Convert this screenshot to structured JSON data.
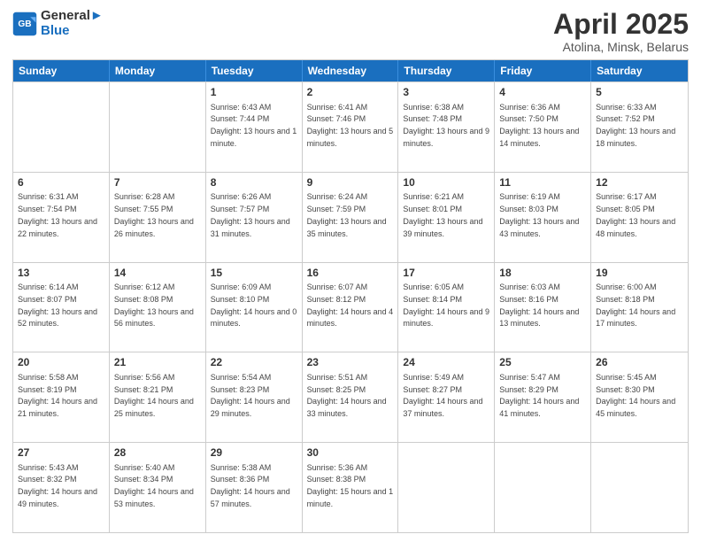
{
  "logo": {
    "line1": "General",
    "line2": "Blue"
  },
  "title": "April 2025",
  "location": "Atolina, Minsk, Belarus",
  "days": [
    "Sunday",
    "Monday",
    "Tuesday",
    "Wednesday",
    "Thursday",
    "Friday",
    "Saturday"
  ],
  "rows": [
    [
      {
        "day": "",
        "sunrise": "",
        "sunset": "",
        "daylight": ""
      },
      {
        "day": "",
        "sunrise": "",
        "sunset": "",
        "daylight": ""
      },
      {
        "day": "1",
        "sunrise": "Sunrise: 6:43 AM",
        "sunset": "Sunset: 7:44 PM",
        "daylight": "Daylight: 13 hours and 1 minute."
      },
      {
        "day": "2",
        "sunrise": "Sunrise: 6:41 AM",
        "sunset": "Sunset: 7:46 PM",
        "daylight": "Daylight: 13 hours and 5 minutes."
      },
      {
        "day": "3",
        "sunrise": "Sunrise: 6:38 AM",
        "sunset": "Sunset: 7:48 PM",
        "daylight": "Daylight: 13 hours and 9 minutes."
      },
      {
        "day": "4",
        "sunrise": "Sunrise: 6:36 AM",
        "sunset": "Sunset: 7:50 PM",
        "daylight": "Daylight: 13 hours and 14 minutes."
      },
      {
        "day": "5",
        "sunrise": "Sunrise: 6:33 AM",
        "sunset": "Sunset: 7:52 PM",
        "daylight": "Daylight: 13 hours and 18 minutes."
      }
    ],
    [
      {
        "day": "6",
        "sunrise": "Sunrise: 6:31 AM",
        "sunset": "Sunset: 7:54 PM",
        "daylight": "Daylight: 13 hours and 22 minutes."
      },
      {
        "day": "7",
        "sunrise": "Sunrise: 6:28 AM",
        "sunset": "Sunset: 7:55 PM",
        "daylight": "Daylight: 13 hours and 26 minutes."
      },
      {
        "day": "8",
        "sunrise": "Sunrise: 6:26 AM",
        "sunset": "Sunset: 7:57 PM",
        "daylight": "Daylight: 13 hours and 31 minutes."
      },
      {
        "day": "9",
        "sunrise": "Sunrise: 6:24 AM",
        "sunset": "Sunset: 7:59 PM",
        "daylight": "Daylight: 13 hours and 35 minutes."
      },
      {
        "day": "10",
        "sunrise": "Sunrise: 6:21 AM",
        "sunset": "Sunset: 8:01 PM",
        "daylight": "Daylight: 13 hours and 39 minutes."
      },
      {
        "day": "11",
        "sunrise": "Sunrise: 6:19 AM",
        "sunset": "Sunset: 8:03 PM",
        "daylight": "Daylight: 13 hours and 43 minutes."
      },
      {
        "day": "12",
        "sunrise": "Sunrise: 6:17 AM",
        "sunset": "Sunset: 8:05 PM",
        "daylight": "Daylight: 13 hours and 48 minutes."
      }
    ],
    [
      {
        "day": "13",
        "sunrise": "Sunrise: 6:14 AM",
        "sunset": "Sunset: 8:07 PM",
        "daylight": "Daylight: 13 hours and 52 minutes."
      },
      {
        "day": "14",
        "sunrise": "Sunrise: 6:12 AM",
        "sunset": "Sunset: 8:08 PM",
        "daylight": "Daylight: 13 hours and 56 minutes."
      },
      {
        "day": "15",
        "sunrise": "Sunrise: 6:09 AM",
        "sunset": "Sunset: 8:10 PM",
        "daylight": "Daylight: 14 hours and 0 minutes."
      },
      {
        "day": "16",
        "sunrise": "Sunrise: 6:07 AM",
        "sunset": "Sunset: 8:12 PM",
        "daylight": "Daylight: 14 hours and 4 minutes."
      },
      {
        "day": "17",
        "sunrise": "Sunrise: 6:05 AM",
        "sunset": "Sunset: 8:14 PM",
        "daylight": "Daylight: 14 hours and 9 minutes."
      },
      {
        "day": "18",
        "sunrise": "Sunrise: 6:03 AM",
        "sunset": "Sunset: 8:16 PM",
        "daylight": "Daylight: 14 hours and 13 minutes."
      },
      {
        "day": "19",
        "sunrise": "Sunrise: 6:00 AM",
        "sunset": "Sunset: 8:18 PM",
        "daylight": "Daylight: 14 hours and 17 minutes."
      }
    ],
    [
      {
        "day": "20",
        "sunrise": "Sunrise: 5:58 AM",
        "sunset": "Sunset: 8:19 PM",
        "daylight": "Daylight: 14 hours and 21 minutes."
      },
      {
        "day": "21",
        "sunrise": "Sunrise: 5:56 AM",
        "sunset": "Sunset: 8:21 PM",
        "daylight": "Daylight: 14 hours and 25 minutes."
      },
      {
        "day": "22",
        "sunrise": "Sunrise: 5:54 AM",
        "sunset": "Sunset: 8:23 PM",
        "daylight": "Daylight: 14 hours and 29 minutes."
      },
      {
        "day": "23",
        "sunrise": "Sunrise: 5:51 AM",
        "sunset": "Sunset: 8:25 PM",
        "daylight": "Daylight: 14 hours and 33 minutes."
      },
      {
        "day": "24",
        "sunrise": "Sunrise: 5:49 AM",
        "sunset": "Sunset: 8:27 PM",
        "daylight": "Daylight: 14 hours and 37 minutes."
      },
      {
        "day": "25",
        "sunrise": "Sunrise: 5:47 AM",
        "sunset": "Sunset: 8:29 PM",
        "daylight": "Daylight: 14 hours and 41 minutes."
      },
      {
        "day": "26",
        "sunrise": "Sunrise: 5:45 AM",
        "sunset": "Sunset: 8:30 PM",
        "daylight": "Daylight: 14 hours and 45 minutes."
      }
    ],
    [
      {
        "day": "27",
        "sunrise": "Sunrise: 5:43 AM",
        "sunset": "Sunset: 8:32 PM",
        "daylight": "Daylight: 14 hours and 49 minutes."
      },
      {
        "day": "28",
        "sunrise": "Sunrise: 5:40 AM",
        "sunset": "Sunset: 8:34 PM",
        "daylight": "Daylight: 14 hours and 53 minutes."
      },
      {
        "day": "29",
        "sunrise": "Sunrise: 5:38 AM",
        "sunset": "Sunset: 8:36 PM",
        "daylight": "Daylight: 14 hours and 57 minutes."
      },
      {
        "day": "30",
        "sunrise": "Sunrise: 5:36 AM",
        "sunset": "Sunset: 8:38 PM",
        "daylight": "Daylight: 15 hours and 1 minute."
      },
      {
        "day": "",
        "sunrise": "",
        "sunset": "",
        "daylight": ""
      },
      {
        "day": "",
        "sunrise": "",
        "sunset": "",
        "daylight": ""
      },
      {
        "day": "",
        "sunrise": "",
        "sunset": "",
        "daylight": ""
      }
    ]
  ]
}
